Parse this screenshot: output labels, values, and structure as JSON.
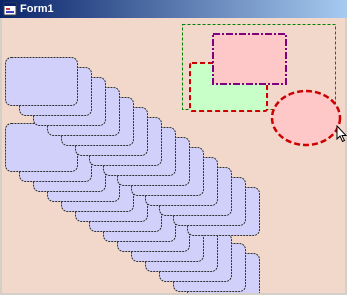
{
  "window": {
    "title": "Form1",
    "icon": "form-app-icon",
    "client_background": "#f1d8cb",
    "titlebar_color": "#0a246a"
  },
  "canvas": {
    "shapes": {
      "stack_card_fill": "#d0d0fa",
      "stack_card_border": "#303030",
      "selection_border": "#008000",
      "pink_rect_fill": "#ffc8c8",
      "pink_rect_border": "#800080",
      "green_rect_fill": "#c8ffc8",
      "green_rect_border": "#cc0000",
      "ellipse_fill": "#ffc8c8",
      "ellipse_border": "#cc0000"
    }
  },
  "cursor": "mouse-pointer-icon"
}
